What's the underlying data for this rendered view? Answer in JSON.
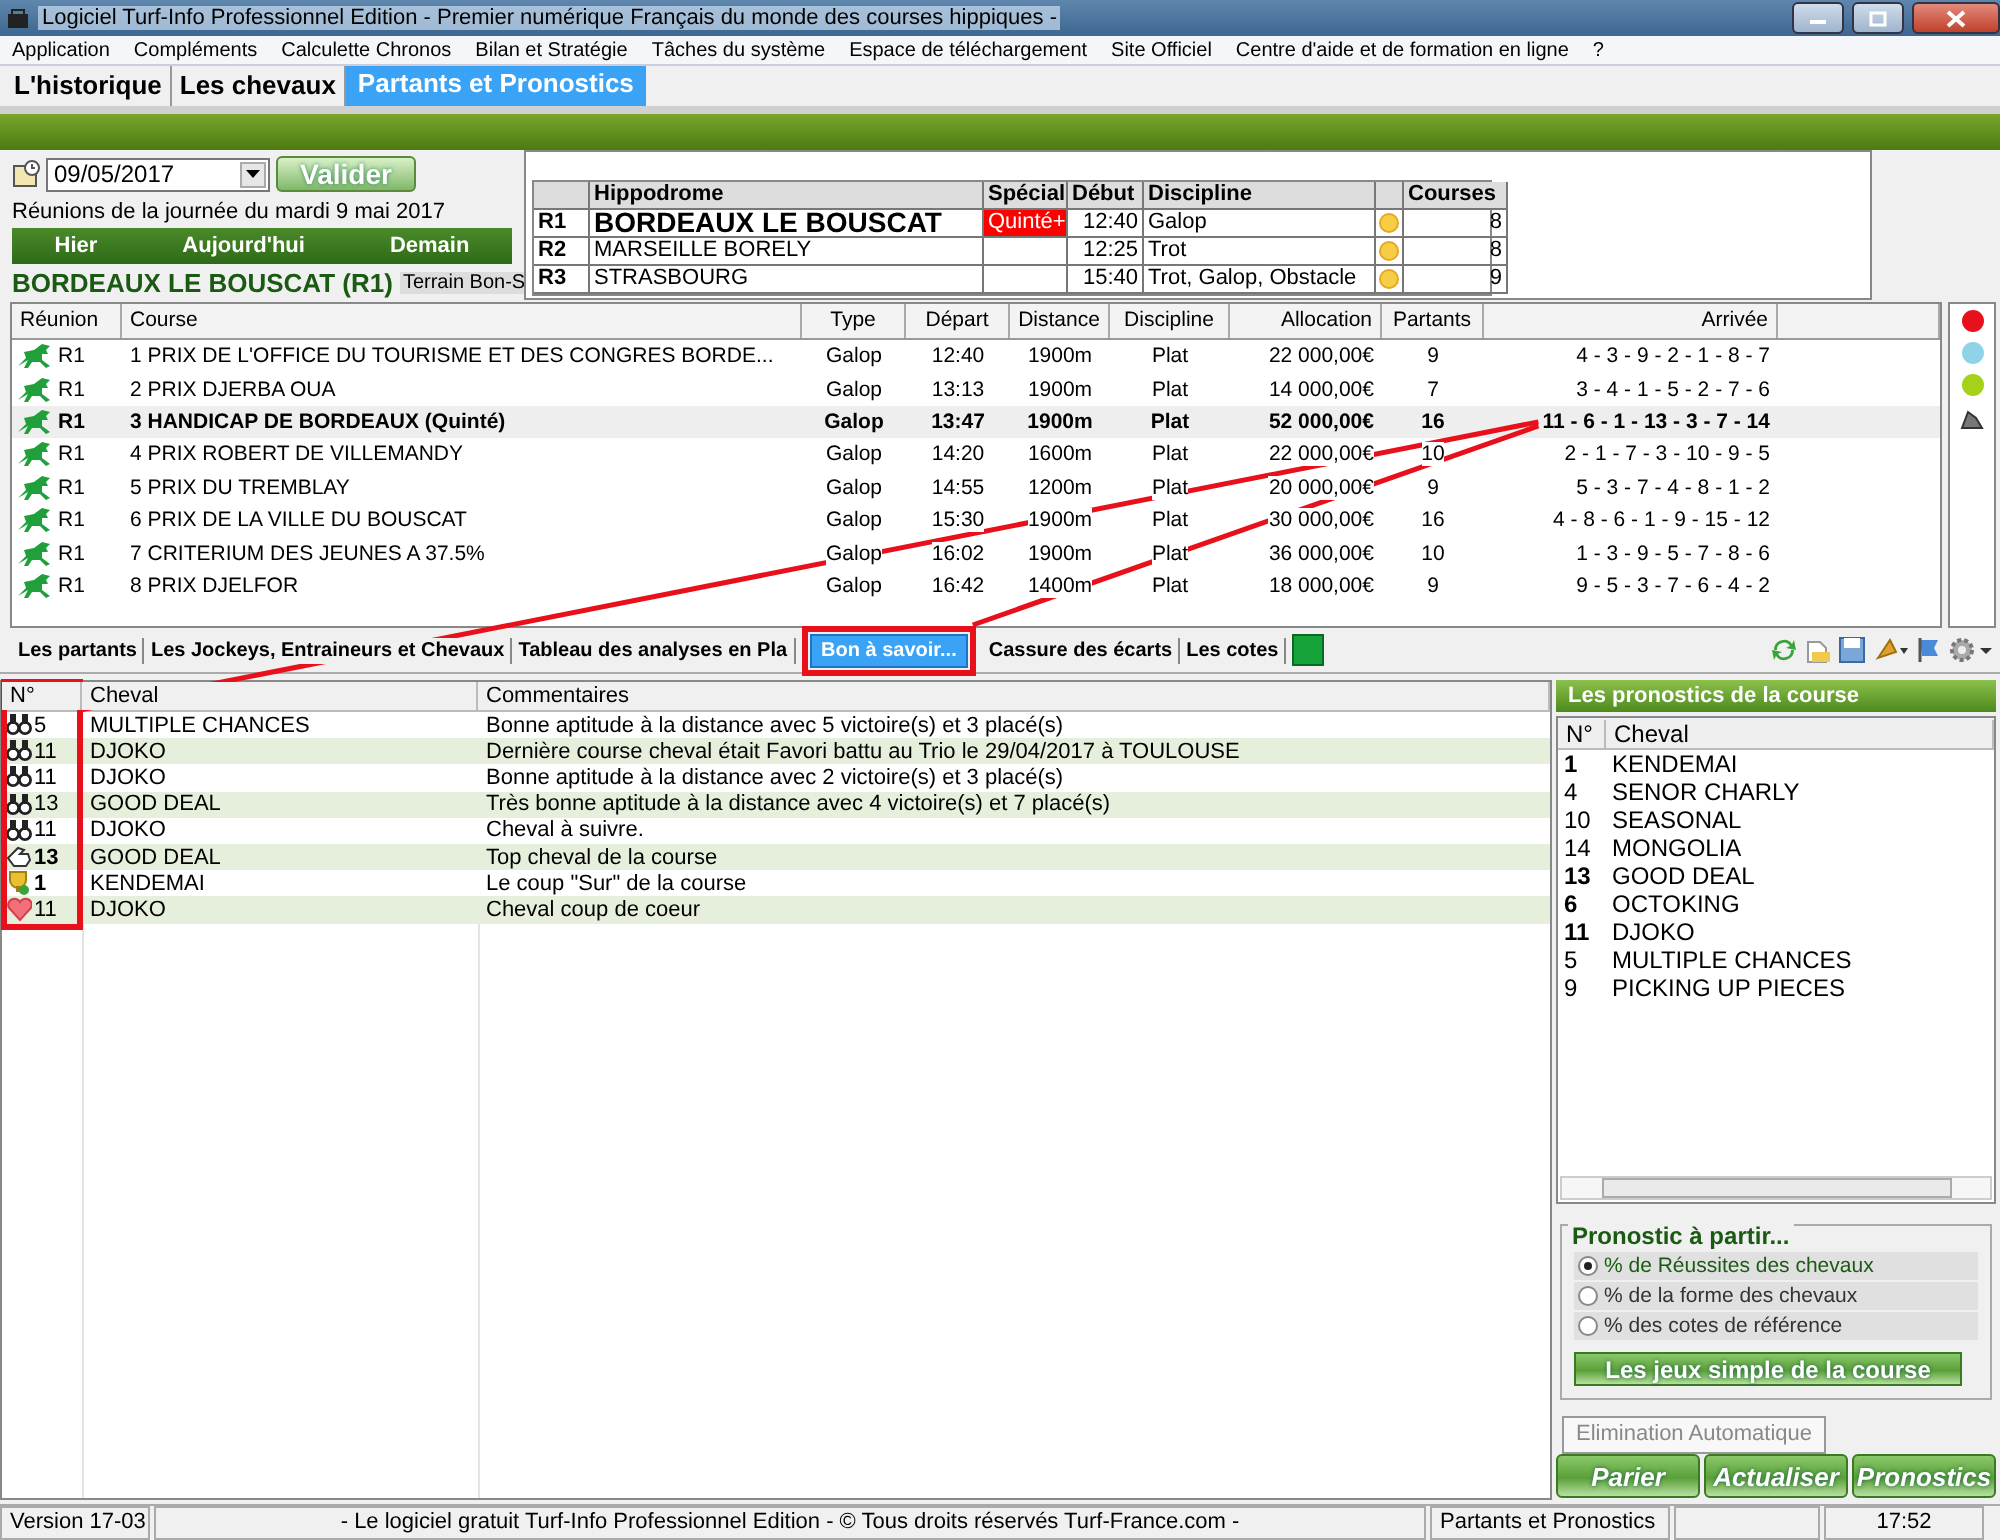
{
  "window": {
    "title": "Logiciel Turf-Info Professionnel Edition - Premier numérique Français du monde des courses hippiques -"
  },
  "menu": [
    "Application",
    "Compléments",
    "Calculette Chronos",
    "Bilan et Stratégie",
    "Tâches du système",
    "Espace de téléchargement",
    "Site Officiel",
    "Centre d'aide et de formation en ligne",
    "?"
  ],
  "main_tabs": [
    {
      "label": "L'historique",
      "selected": false
    },
    {
      "label": "Les chevaux",
      "selected": false
    },
    {
      "label": "Partants et Pronostics",
      "selected": true
    }
  ],
  "date_picker": {
    "value": "09/05/2017",
    "button": "Valider"
  },
  "day_caption": "Réunions de la journée du mardi 9 mai 2017",
  "day_nav": [
    "Hier",
    "Aujourd'hui",
    "Demain"
  ],
  "venue": {
    "title": "BORDEAUX LE BOUSCAT (R1)",
    "terrain": "Terrain Bon-S"
  },
  "meetings": {
    "columns": [
      "Hippodrome",
      "Spécial",
      "Début",
      "Discipline",
      "Courses"
    ],
    "rows": [
      {
        "code": "R1",
        "hippodrome": "BORDEAUX LE BOUSCAT",
        "special": "Quinté+",
        "start": "12:40",
        "discipline": "Galop",
        "courses": "8",
        "selected": true
      },
      {
        "code": "R2",
        "hippodrome": "MARSEILLE BORELY",
        "start": "12:25",
        "discipline": "Trot",
        "courses": "8",
        "selected": false
      },
      {
        "code": "R3",
        "hippodrome": "STRASBOURG",
        "start": "15:40",
        "discipline": "Trot, Galop, Obstacle",
        "courses": "9",
        "selected": false
      }
    ]
  },
  "races": {
    "columns": [
      "Réunion",
      "Course",
      "Type",
      "Départ",
      "Distance",
      "Discipline",
      "Allocation",
      "Partants",
      "Arrivée"
    ],
    "rows": [
      {
        "meeting": "R1",
        "course": "1 PRIX DE L'OFFICE DU TOURISME ET DES CONGRES BORDE...",
        "type": "Galop",
        "start": "12:40",
        "distance": "1900m",
        "discipline": "Plat",
        "allocation": "22 000,00€",
        "runners": "9",
        "arrival": "4 - 3 - 9 - 2 - 1 - 8 - 7",
        "selected": false
      },
      {
        "meeting": "R1",
        "course": "2 PRIX DJERBA OUA",
        "type": "Galop",
        "start": "13:13",
        "distance": "1900m",
        "discipline": "Plat",
        "allocation": "14 000,00€",
        "runners": "7",
        "arrival": "3 - 4 - 1 - 5 - 2 - 7 - 6",
        "selected": false
      },
      {
        "meeting": "R1",
        "course": "3 HANDICAP DE BORDEAUX (Quinté)",
        "type": "Galop",
        "start": "13:47",
        "distance": "1900m",
        "discipline": "Plat",
        "allocation": "52 000,00€",
        "runners": "16",
        "arrival": "11 - 6 - 1 - 13 - 3 - 7 - 14",
        "selected": true
      },
      {
        "meeting": "R1",
        "course": "4 PRIX ROBERT DE VILLEMANDY",
        "type": "Galop",
        "start": "14:20",
        "distance": "1600m",
        "discipline": "Plat",
        "allocation": "22 000,00€",
        "runners": "10",
        "arrival": "2 - 1 - 7 - 3 - 10 - 9 - 5",
        "selected": false
      },
      {
        "meeting": "R1",
        "course": "5 PRIX DU TREMBLAY",
        "type": "Galop",
        "start": "14:55",
        "distance": "1200m",
        "discipline": "Plat",
        "allocation": "20 000,00€",
        "runners": "9",
        "arrival": "5 - 3 - 7 - 4 - 8 - 1 - 2",
        "selected": false
      },
      {
        "meeting": "R1",
        "course": "6 PRIX DE LA VILLE DU BOUSCAT",
        "type": "Galop",
        "start": "15:30",
        "distance": "1900m",
        "discipline": "Plat",
        "allocation": "30 000,00€",
        "runners": "16",
        "arrival": "4 - 8 - 6 - 1 - 9 - 15 - 12",
        "selected": false
      },
      {
        "meeting": "R1",
        "course": "7 CRITERIUM DES JEUNES A 37.5%",
        "type": "Galop",
        "start": "16:02",
        "distance": "1900m",
        "discipline": "Plat",
        "allocation": "36 000,00€",
        "runners": "10",
        "arrival": "1 - 3 - 9 - 5 - 7 - 8 - 6",
        "selected": false
      },
      {
        "meeting": "R1",
        "course": "8 PRIX DJELFOR",
        "type": "Galop",
        "start": "16:42",
        "distance": "1400m",
        "discipline": "Plat",
        "allocation": "18 000,00€",
        "runners": "9",
        "arrival": "9 - 5 - 3 - 7 - 6 - 4 - 2",
        "selected": false
      }
    ]
  },
  "legend_dots": [
    {
      "color": "#e8101a"
    },
    {
      "color": "#8fd3e8"
    },
    {
      "color": "#a6d11a"
    }
  ],
  "sub_tabs": [
    {
      "label": "Les partants",
      "selected": false
    },
    {
      "label": "Les Jockeys, Entraineurs et Chevaux",
      "selected": false
    },
    {
      "label": "Tableau des analyses en Pla",
      "selected": false
    },
    {
      "label": "Bon à savoir...",
      "selected": true
    },
    {
      "label": "Cassure des écarts",
      "selected": false
    },
    {
      "label": "Les cotes",
      "selected": false
    }
  ],
  "tips": {
    "columns": [
      "N°",
      "Cheval",
      "Commentaires"
    ],
    "rows": [
      {
        "kind": "binoculars",
        "number": "5",
        "horse": "MULTIPLE CHANCES",
        "comment": "Bonne aptitude à la distance avec 5 victoire(s) et 3 placé(s)",
        "bold": false
      },
      {
        "kind": "binoculars",
        "number": "11",
        "horse": "DJOKO",
        "comment": "Dernière course cheval était Favori battu au Trio le 29/04/2017 à TOULOUSE",
        "bold": false
      },
      {
        "kind": "binoculars",
        "number": "11",
        "horse": "DJOKO",
        "comment": "Bonne aptitude à la distance avec 2 victoire(s) et 3 placé(s)",
        "bold": false
      },
      {
        "kind": "binoculars",
        "number": "13",
        "horse": "GOOD DEAL",
        "comment": "Très bonne aptitude à la distance avec 4 victoire(s) et 7 placé(s)",
        "bold": false
      },
      {
        "kind": "binoculars",
        "number": "11",
        "horse": "DJOKO",
        "comment": "Cheval à suivre.",
        "bold": false
      },
      {
        "kind": "hand",
        "number": "13",
        "horse": "GOOD DEAL",
        "comment": "Top cheval de la course",
        "bold": true
      },
      {
        "kind": "trophy",
        "number": "1",
        "horse": "KENDEMAI",
        "comment": "Le coup \"Sur\" de la course",
        "bold": true
      },
      {
        "kind": "heart",
        "number": "11",
        "horse": "DJOKO",
        "comment": "Cheval coup de coeur",
        "bold": false
      }
    ]
  },
  "forecast": {
    "title": "Les pronostics de la course",
    "columns": [
      "N°",
      "Cheval"
    ],
    "rows": [
      {
        "number": "1",
        "horse": "KENDEMAI",
        "bold": true
      },
      {
        "number": "4",
        "horse": "SENOR CHARLY",
        "bold": false
      },
      {
        "number": "10",
        "horse": "SEASONAL",
        "bold": false
      },
      {
        "number": "14",
        "horse": "MONGOLIA",
        "bold": false
      },
      {
        "number": "13",
        "horse": "GOOD DEAL",
        "bold": true
      },
      {
        "number": "6",
        "horse": "OCTOKING",
        "bold": true
      },
      {
        "number": "11",
        "horse": "DJOKO",
        "bold": true
      },
      {
        "number": "5",
        "horse": "MULTIPLE CHANCES",
        "bold": false
      },
      {
        "number": "9",
        "horse": "PICKING UP PIECES",
        "bold": false
      }
    ],
    "basis": {
      "legend": "Pronostic à partir...",
      "options": [
        {
          "label": "% de Réussites des chevaux",
          "selected": true
        },
        {
          "label": "% de la forme des chevaux",
          "selected": false
        },
        {
          "label": "% des cotes de référence",
          "selected": false
        }
      ]
    },
    "simple_bets_button": "Les jeux simple de la course",
    "elimination_button": {
      "label": "Elimination Automatique",
      "disabled": true
    },
    "actions": [
      "Parier",
      "Actualiser",
      "Pronostics"
    ]
  },
  "status_bar": [
    "Version 17-03",
    "- Le logiciel gratuit Turf-Info Professionnel Edition - © Tous droits réservés Turf-France.com -",
    "Partants et Pronostics",
    "17:52"
  ]
}
